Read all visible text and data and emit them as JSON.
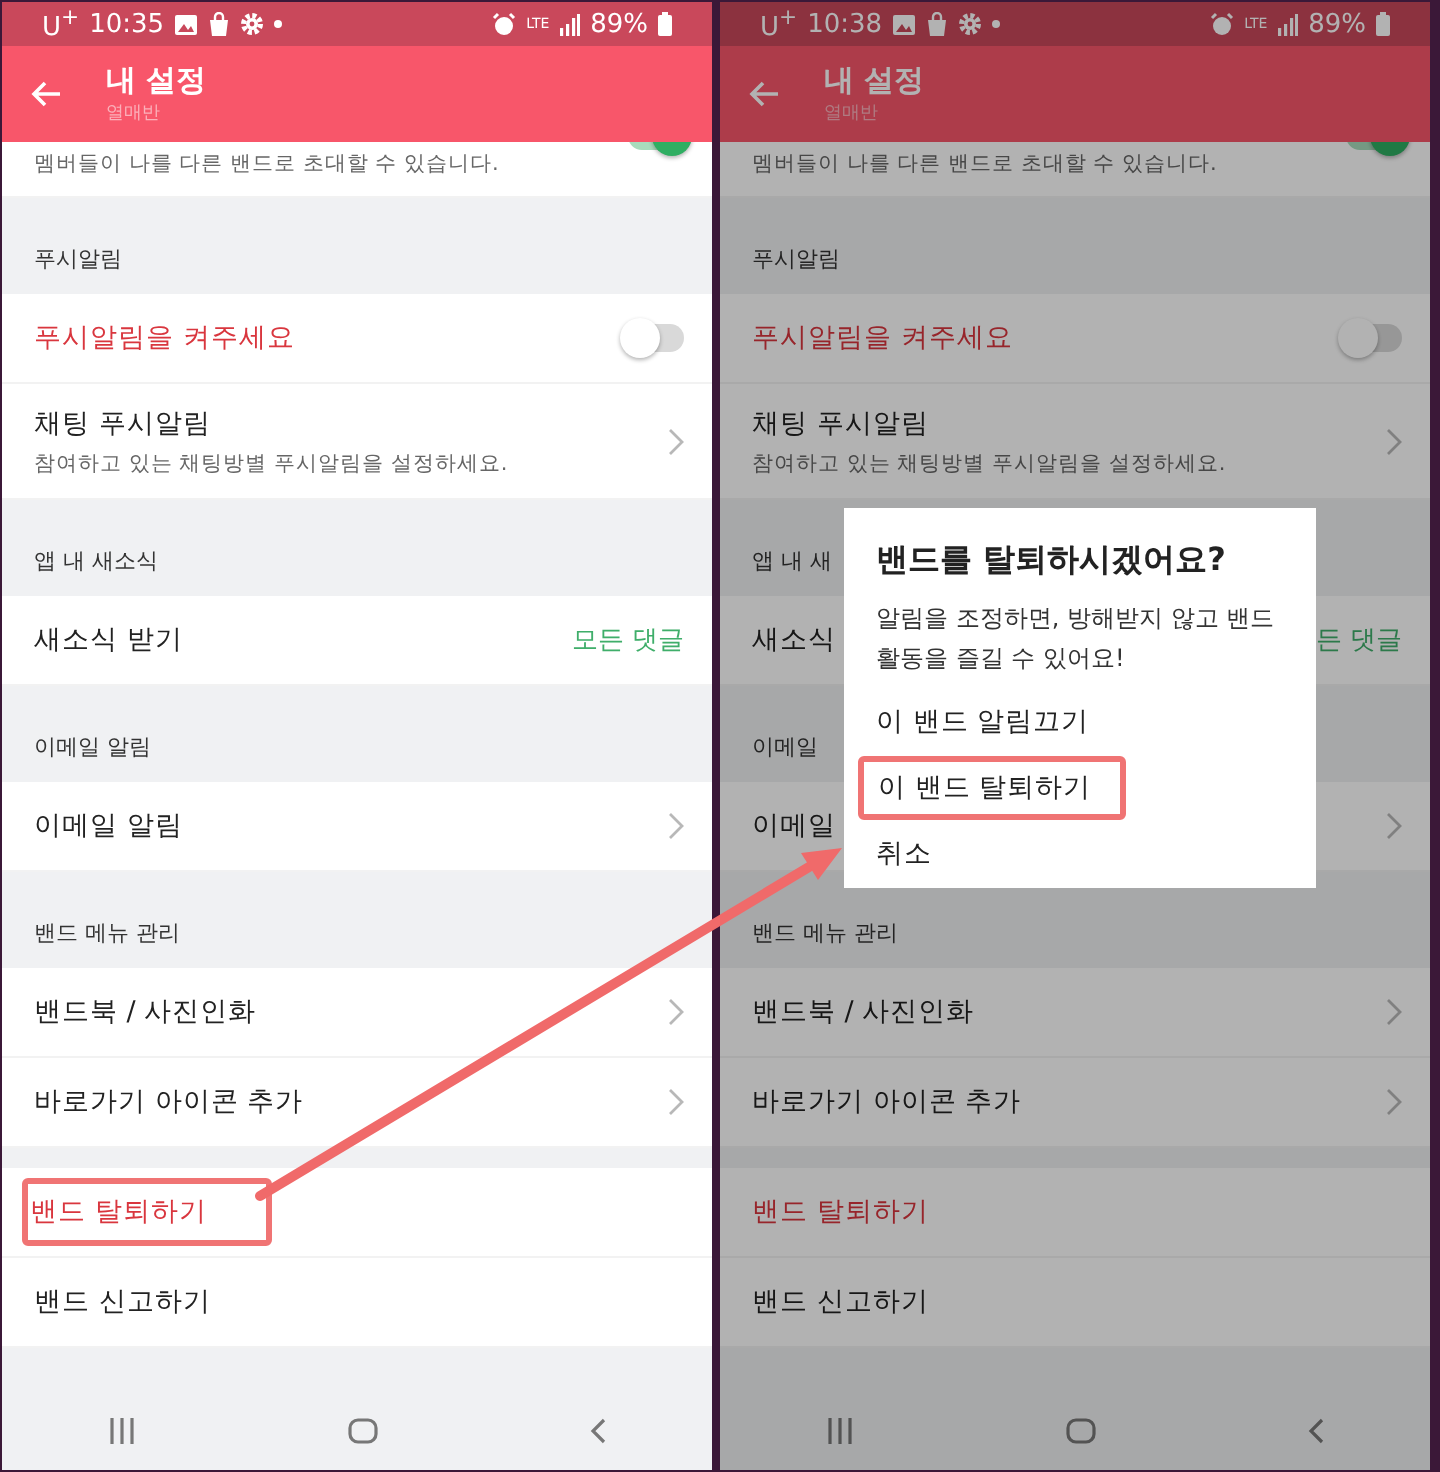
{
  "screens": [
    {
      "status_bar": {
        "carrier": "U$^{+}$",
        "time": "10:35",
        "network": "LTE",
        "battery": "89%"
      },
      "app_bar": {
        "title": "내 설정",
        "subtitle": "열매반"
      },
      "items": [
        {
          "kind": "partial_toggle",
          "description": "멤버들이 나를 다른 밴드로 초대할 수 있습니다.",
          "on": true
        },
        {
          "kind": "header",
          "label": "푸시알림"
        },
        {
          "kind": "toggle",
          "label": "푸시알림을 켜주세요",
          "on": false,
          "alert": true,
          "highlighted": false
        },
        {
          "kind": "link",
          "label": "채팅 푸시알림",
          "description": "참여하고 있는 채팅방별 푸시알림을 설정하세요.",
          "alert": false,
          "highlighted": false
        },
        {
          "kind": "header",
          "label": "앱 내 새소식"
        },
        {
          "kind": "value",
          "label": "새소식 받기",
          "value": "모든 댓글",
          "alert": false,
          "highlighted": false
        },
        {
          "kind": "header",
          "label": "이메일 알림"
        },
        {
          "kind": "link",
          "label": "이메일 알림",
          "alert": false,
          "highlighted": false
        },
        {
          "kind": "header",
          "label": "밴드 메뉴 관리"
        },
        {
          "kind": "link",
          "label": "밴드북 / 사진인화",
          "alert": false,
          "highlighted": false
        },
        {
          "kind": "link",
          "label": "바로가기 아이콘 추가",
          "alert": false,
          "highlighted": false
        },
        {
          "kind": "spacer"
        },
        {
          "kind": "plain",
          "label": "밴드 탈퇴하기",
          "alert": true,
          "highlighted": true
        },
        {
          "kind": "plain",
          "label": "밴드 신고하기",
          "alert": false,
          "highlighted": false
        }
      ]
    },
    {
      "dimmed": true,
      "status_bar": {
        "carrier": "U$^{+}$",
        "time": "10:38",
        "network": "LTE",
        "battery": "89%"
      },
      "app_bar": {
        "title": "내 설정",
        "subtitle": "열매반"
      },
      "items": [
        {
          "kind": "partial_toggle",
          "description": "멤버들이 나를 다른 밴드로 초대할 수 있습니다.",
          "on": true
        },
        {
          "kind": "header",
          "label": "푸시알림"
        },
        {
          "kind": "toggle",
          "label": "푸시알림을 켜주세요",
          "on": false,
          "alert": true,
          "highlighted": false
        },
        {
          "kind": "link",
          "label": "채팅 푸시알림",
          "description": "참여하고 있는 채팅방별 푸시알림을 설정하세요.",
          "alert": false,
          "highlighted": false
        },
        {
          "kind": "header",
          "label": "앱 내 새"
        },
        {
          "kind": "value",
          "label": "새소식",
          "value": "든 댓글",
          "alert": false,
          "highlighted": false
        },
        {
          "kind": "header",
          "label": "이메일"
        },
        {
          "kind": "link",
          "label": "이메일",
          "alert": false,
          "highlighted": false
        },
        {
          "kind": "header",
          "label": "밴드 메뉴 관리"
        },
        {
          "kind": "link",
          "label": "밴드북 / 사진인화",
          "alert": false,
          "highlighted": false
        },
        {
          "kind": "link",
          "label": "바로가기 아이콘 추가",
          "alert": false,
          "highlighted": false
        },
        {
          "kind": "spacer"
        },
        {
          "kind": "plain",
          "label": "밴드 탈퇴하기",
          "alert": true,
          "highlighted": false
        },
        {
          "kind": "plain",
          "label": "밴드 신고하기",
          "alert": false,
          "highlighted": false
        }
      ],
      "dialog": {
        "title": "밴드를 탈퇴하시겠어요?",
        "message": "알림을 조정하면, 방해받지 않고 밴드\n활동을 즐길 수 있어요!",
        "options": [
          {
            "label": "이 밴드 알림끄기",
            "highlighted": false
          },
          {
            "label": "이 밴드 탈퇴하기",
            "highlighted": true
          },
          {
            "label": "취소",
            "highlighted": false
          }
        ]
      }
    }
  ]
}
